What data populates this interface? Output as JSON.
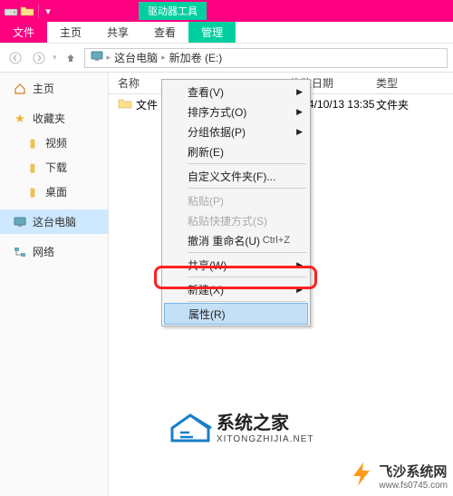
{
  "titlebar": {
    "tool_tab": "驱动器工具"
  },
  "menubar": {
    "file": "文件",
    "home": "主页",
    "share": "共享",
    "view": "查看",
    "manage": "管理"
  },
  "breadcrumb": {
    "this_pc": "这台电脑",
    "volume": "新加卷 (E:)"
  },
  "sidebar": {
    "home": "主页",
    "favorites": "收藏夹",
    "videos": "视频",
    "downloads": "下载",
    "desktop": "桌面",
    "this_pc": "这台电脑",
    "network": "网络"
  },
  "columns": {
    "name": "名称",
    "date": "修改日期",
    "type": "类型"
  },
  "rows": [
    {
      "name": "文件",
      "date": "2014/10/13 13:35",
      "type": "文件夹"
    }
  ],
  "context_menu": {
    "view": "查看(V)",
    "sort": "排序方式(O)",
    "group": "分组依据(P)",
    "refresh": "刷新(E)",
    "customize": "自定义文件夹(F)...",
    "paste": "粘贴(P)",
    "paste_shortcut": "粘贴快捷方式(S)",
    "undo": "撤消 重命名(U)",
    "undo_key": "Ctrl+Z",
    "share": "共享(W)",
    "new": "新建(X)",
    "properties": "属性(R)"
  },
  "watermark1": {
    "title": "系统之家",
    "sub": "XITONGZHIJIA.NET"
  },
  "watermark2": {
    "title": "飞沙系统网",
    "sub": "www.fs0745.com"
  }
}
